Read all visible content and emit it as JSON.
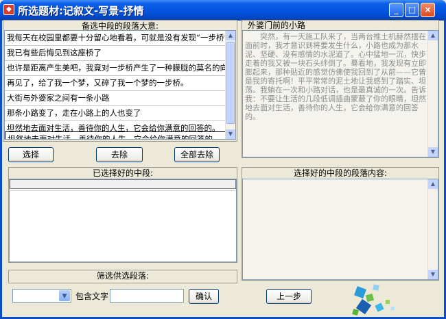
{
  "window": {
    "title": "所选题材:记叙文-写景-抒情",
    "min_label": "_",
    "max_label": "□",
    "close_label": "×"
  },
  "candidates": {
    "heading": "备选中段的段落大意:",
    "items": [
      "我每天在校园里都要十分留心地看着，可就是没有发现“一步桥”",
      "我已有些后悔见到这座桥了",
      "也许是距离产生美吧，我竟对一步桥产生了一种朦胧的莫名的向往",
      "再见了，给了我一个梦，又碎了我一个梦的一步桥。",
      "大街与外婆家之间有一条小路",
      "那条小路变了，走在小路上的人也变了",
      "坦然地去面对生活，善待你的人生，它会给你满意的回答的。"
    ],
    "selected_index": 6
  },
  "buttons": {
    "select": "选择",
    "remove": "去除",
    "remove_all": "全部去除",
    "confirm": "确认",
    "prev_step": "上一步"
  },
  "preview": {
    "heading": "外婆门前的小路",
    "content": "突然，有一天施工队来了，当两台推土机赫然摆在面前时，我才意识到将要发生什么，小路也成为那水泥、坚硬、没有感情的水泥道了。心中猛地一沉，快步走着的我又被一块石头绊倒了。蓦看地，我发现有立即膨起来，那种贴近的感觉仿佛使我回到了从前——它曾是我的寄托啊！平平常常的泥土地让我感到了踏实、坦荡。我躺在一次和小路对话，也是最真诚的一次。告诉我：不要让生活的几段低调插曲蒙蔽了你的眼睛，坦然地去面对生活，善待你的人生，它会给你满意的回答的。"
  },
  "selected_list": {
    "heading": "已选择好的中段:",
    "items": [
      ""
    ]
  },
  "selected_content": {
    "heading": "选择好的中段的段落内容:",
    "content": ""
  },
  "filter": {
    "heading": "筛选供选段落:",
    "contains_label": "包含文字",
    "combo_value": "",
    "text_value": ""
  }
}
